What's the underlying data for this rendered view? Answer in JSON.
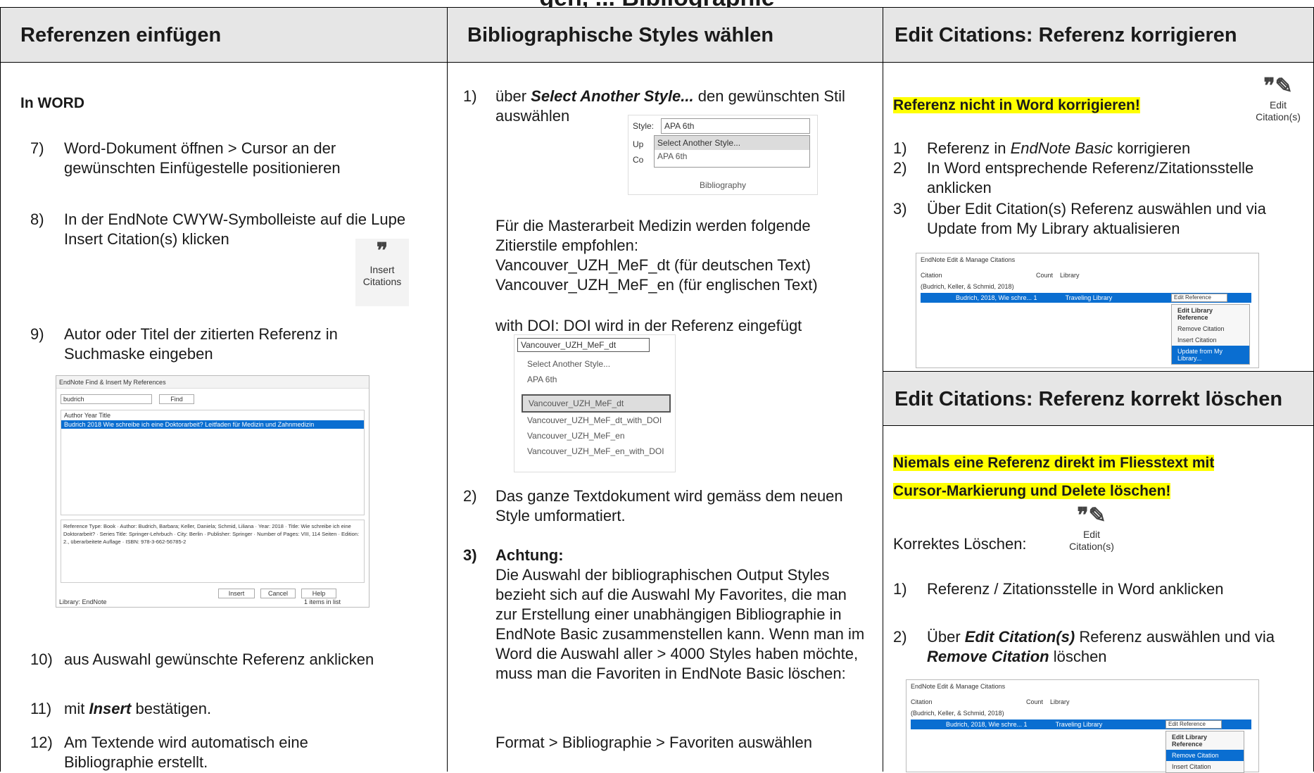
{
  "page_title": "gen, ... Bibliographie",
  "col1": {
    "header": "Referenzen einfügen",
    "section": "In WORD",
    "s7_num": "7)",
    "s7_text": "Word-Dokument öffnen > Cursor an der gewünschten Einfügestelle positionieren",
    "s8_num": "8)",
    "s8_text": "In der EndNote CWYW-Symbolleiste auf die Lupe Insert Citation(s) klicken",
    "icon_insert": "Insert Citations",
    "s9_num": "9)",
    "s9_text": "Autor oder Titel der zitierten Referenz in Suchmaske eingeben",
    "find_dialog": {
      "title": "EndNote Find & Insert My References",
      "search": "budrich",
      "find_btn": "Find",
      "cols": "Author   Year   Title",
      "row": "Budrich   2018   Wie schreibe ich eine Doktorarbeit? Leitfaden für Medizin und Zahnmedizin",
      "details": "Reference Type: Book · Author: Budrich, Barbara; Keller, Daniela; Schmid, Liliana · Year: 2018 · Title: Wie schreibe ich eine Doktorarbeit? · Series Title: Springer-Lehrbuch · City: Berlin · Publisher: Springer · Number of Pages: VIII, 114 Seiten · Edition: 2., überarbeitete Auflage · ISBN: 978-3-662-56785-2",
      "insert": "Insert",
      "cancel": "Cancel",
      "help": "Help",
      "library": "Library: EndNote",
      "count": "1 items in list"
    },
    "s10_num": "10)",
    "s10_text": "aus Auswahl gewünschte Referenz anklicken",
    "s11_num": "11)",
    "s11_pre": "mit ",
    "s11_bold": "Insert",
    "s11_post": " bestätigen.",
    "s12_num": "12)",
    "s12_text": "Am Textende wird automatisch eine Bibliographie erstellt."
  },
  "col2": {
    "header": "Bibliographische Styles wählen",
    "s1_num": "1)",
    "s1_pre": "über ",
    "s1_bold": "Select Another Style...",
    "s1_post": " den gewünschten Stil auswählen",
    "style_box": {
      "label": "Style:",
      "value": "APA 6th",
      "item1": "Select Another Style...",
      "item2": "APA 6th",
      "up": "Up",
      "co": "Co",
      "footer": "Bibliography"
    },
    "p1": "Für die Masterarbeit Medizin werden folgende Zitierstile empfohlen:",
    "p2": "Vancouver_UZH_MeF_dt (für deutschen Text)",
    "p3": "Vancouver_UZH_MeF_en (für englischen Text)",
    "p4": "with DOI: DOI wird in der Referenz eingefügt",
    "dd": {
      "value": "Vancouver_UZH_MeF_dt",
      "items": [
        "Select Another Style...",
        "APA 6th",
        "Vancouver_UZH_MeF_dt",
        "Vancouver_UZH_MeF_dt_with_DOI",
        "Vancouver_UZH_MeF_en",
        "Vancouver_UZH_MeF_en_with_DOI"
      ]
    },
    "s2_num": "2)",
    "s2_text": "Das ganze Textdokument wird gemäss dem neuen Style umformatiert.",
    "s3_num": "3)",
    "s3_head": "Achtung:",
    "s3_text": "Die Auswahl der bibliographischen Output Styles bezieht sich auf die Auswahl My Favorites, die man zur Erstellung einer unabhängigen Bibliographie in EndNote Basic zusammenstellen kann. Wenn man im Word die Auswahl aller > 4000 Styles haben möchte, muss man die Favoriten in EndNote Basic löschen:",
    "s3_path": "Format > Bibliographie > Favoriten auswählen"
  },
  "col3": {
    "header": "Edit Citations: Referenz korrigieren",
    "warn1": "Referenz nicht in Word korrigieren!",
    "icon_edit": "Edit Citation(s)",
    "k1_num": "1)",
    "k1_pre": "Referenz in ",
    "k1_it": "EndNote Basic",
    "k1_post": " korrigieren",
    "k2_num": "2)",
    "k2_text": "In Word entsprechende Referenz/Zitationsstelle anklicken",
    "k3_num": "3)",
    "k3_text": "Über Edit Citation(s) Referenz auswählen und via Update from My Library aktualisieren",
    "dlg": {
      "title": "EndNote Edit & Manage Citations",
      "citation": "Citation",
      "count": "Count",
      "library": "Library",
      "group": "(Budrich, Keller, & Schmid, 2018)",
      "row": "Budrich, 2018, Wie schre...   1",
      "lib": "Traveling Library",
      "edit_ref": "Edit Reference",
      "m1": "Edit Library Reference",
      "m2": "Remove Citation",
      "m3": "Insert Citation",
      "m4": "Update from My Library..."
    },
    "header2": "Edit Citations: Referenz korrekt löschen",
    "warn2a": "Niemals eine Referenz direkt im Fliesstext mit",
    "warn2b": "Cursor-Markierung und Delete löschen!",
    "korrekt": "Korrektes Löschen:",
    "l1_num": "1)",
    "l1_text": "Referenz / Zitationsstelle in Word anklicken",
    "l2_num": "2)",
    "l2_pre": "Über ",
    "l2_bold": "Edit Citation(s)",
    "l2_mid": " Referenz auswählen und via ",
    "l2_bold2": "Remove Citation",
    "l2_post": " löschen"
  }
}
